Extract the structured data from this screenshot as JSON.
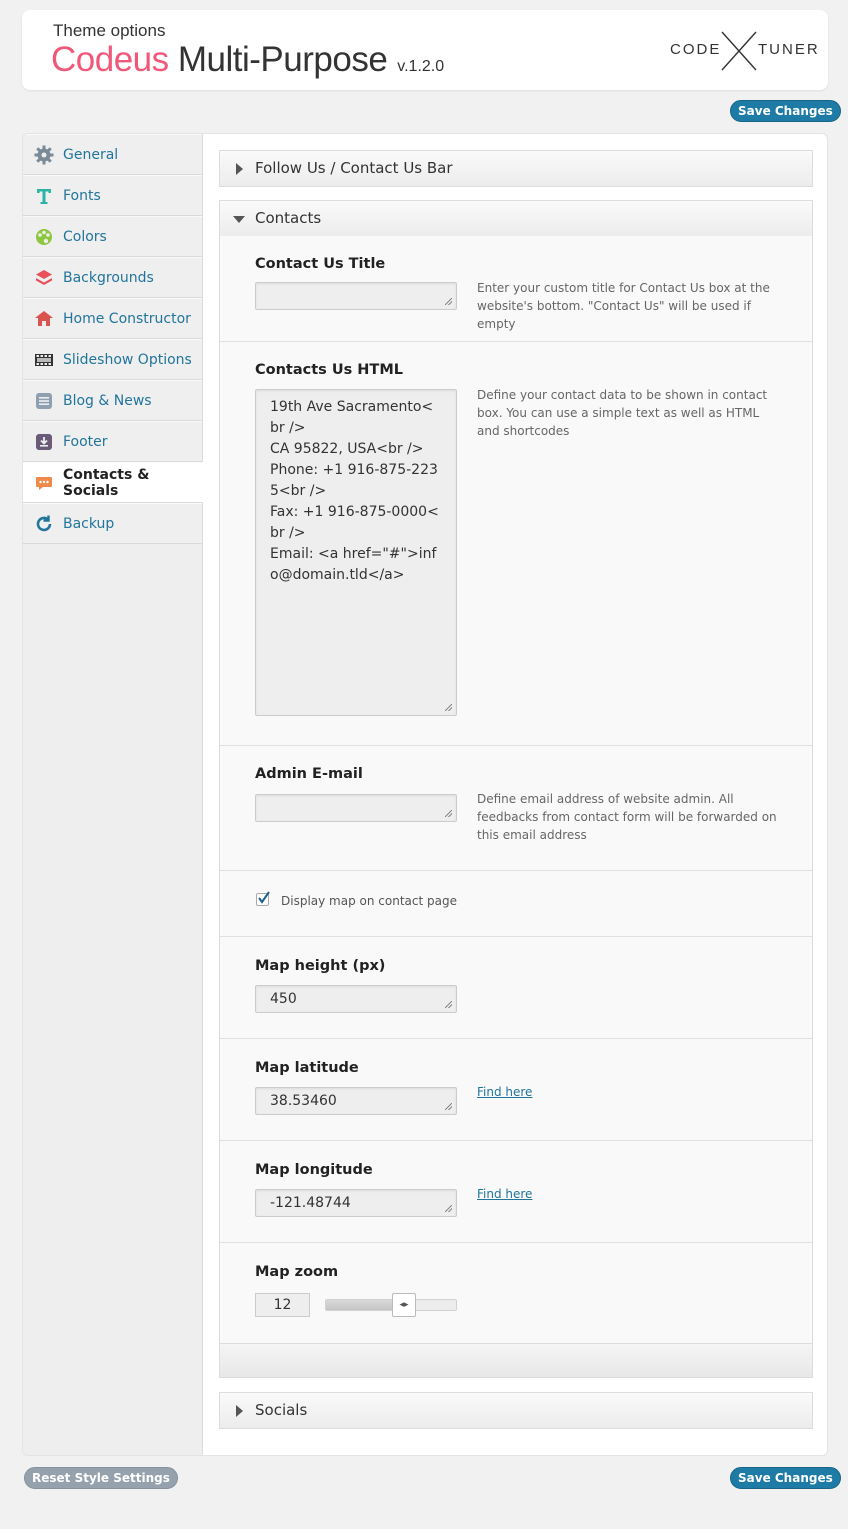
{
  "header": {
    "subtitle": "Theme options",
    "brand": "Codeus",
    "product": " Multi-Purpose",
    "version": "v.1.2.0",
    "logo_left": "CODE",
    "logo_right": "TUNER"
  },
  "buttons": {
    "save_top": "Save Changes",
    "save_bottom": "Save Changes",
    "reset": "Reset Style Settings"
  },
  "sidebar": {
    "items": [
      {
        "label": "General",
        "icon": "gear-icon",
        "color": "#7a8a98"
      },
      {
        "label": "Fonts",
        "icon": "font-icon",
        "color": "#2bb3a5"
      },
      {
        "label": "Colors",
        "icon": "palette-icon",
        "color": "#8dc63f"
      },
      {
        "label": "Backgrounds",
        "icon": "layers-icon",
        "color": "#e8505b"
      },
      {
        "label": "Home Constructor",
        "icon": "home-icon",
        "color": "#d9534f"
      },
      {
        "label": "Slideshow Options",
        "icon": "film-icon",
        "color": "#333333"
      },
      {
        "label": "Blog & News",
        "icon": "list-icon",
        "color": "#8fa0b0"
      },
      {
        "label": "Footer",
        "icon": "download-icon",
        "color": "#6a5a78"
      },
      {
        "label": "Contacts & Socials",
        "icon": "chat-icon",
        "color": "#f08a4b"
      },
      {
        "label": "Backup",
        "icon": "refresh-icon",
        "color": "#21759b"
      }
    ],
    "active_index": 8
  },
  "sections": {
    "follow": "Follow Us / Contact Us Bar",
    "contacts": "Contacts",
    "socials": "Socials"
  },
  "fields": {
    "contact_title": {
      "label": "Contact Us Title",
      "value": "",
      "desc": "Enter your custom title for Contact Us box at the website's bottom. \"Contact Us\" will be used if empty"
    },
    "contact_html": {
      "label": "Contacts Us HTML",
      "value": "19th Ave Sacramento<br />\nCA 95822, USA<br />\nPhone: +1 916-875-2235<br />\nFax: +1 916-875-0000<br />\nEmail: <a href=\"#\">info@domain.tld</a>",
      "desc": "Define your contact data to be shown in contact box. You can use a simple text as well as HTML and shortcodes"
    },
    "admin_email": {
      "label": "Admin E-mail",
      "value": "",
      "desc": "Define email address of website admin. All feedbacks from contact form will be forwarded on this email address"
    },
    "display_map": {
      "label": "Display map on contact page",
      "checked": true
    },
    "map_height": {
      "label": "Map height (px)",
      "value": "450"
    },
    "map_latitude": {
      "label": "Map latitude",
      "value": "38.53460",
      "link": "Find here"
    },
    "map_longitude": {
      "label": "Map longitude",
      "value": "-121.48744",
      "link": "Find here"
    },
    "map_zoom": {
      "label": "Map zoom",
      "value": "12",
      "slider_fraction": 0.6
    }
  }
}
